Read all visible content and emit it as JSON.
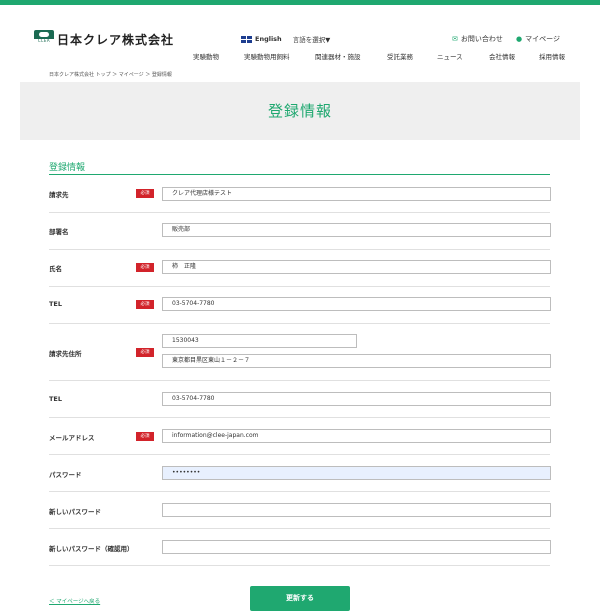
{
  "brand": {
    "name": "日本クレア株式会社",
    "mark_text": "CLEA",
    "accent": "#1fa870"
  },
  "header": {
    "lang_label": "English",
    "lang_select": "言語を選択▼",
    "contact": "お問い合わせ",
    "mypage": "マイページ",
    "nav": [
      "実験動物",
      "実験動物用飼料",
      "関連器材・施設",
      "受託業務",
      "ニュース",
      "会社情報",
      "採用情報"
    ]
  },
  "breadcrumb": "日本クレア株式会社 トップ ＞ マイページ ＞ 登録情報",
  "page_title": "登録情報",
  "section_title": "登録情報",
  "required_label": "必須",
  "fields": [
    {
      "label": "請求先",
      "required": true,
      "value": "クレア代理店様テスト"
    },
    {
      "label": "部署名",
      "required": false,
      "value": "販売部"
    },
    {
      "label": "氏名",
      "required": true,
      "value": "柿　正隆"
    },
    {
      "label": "TEL",
      "required": true,
      "value": "03-5704-7780"
    },
    {
      "label": "請求先住所",
      "required": true,
      "value": "1530043",
      "value2": "東京都目黒区東山１－２－７"
    },
    {
      "label": "TEL",
      "required": false,
      "value": "03-5704-7780"
    },
    {
      "label": "メールアドレス",
      "required": true,
      "value": "information@clee-japan.com"
    },
    {
      "label": "パスワード",
      "required": false,
      "value": "••••••••"
    },
    {
      "label": "新しいパスワード",
      "required": false,
      "value": ""
    },
    {
      "label": "新しいパスワード（確認用）",
      "required": false,
      "value": ""
    }
  ],
  "back_link": "＜ マイページへ戻る",
  "submit_label": "更新する"
}
